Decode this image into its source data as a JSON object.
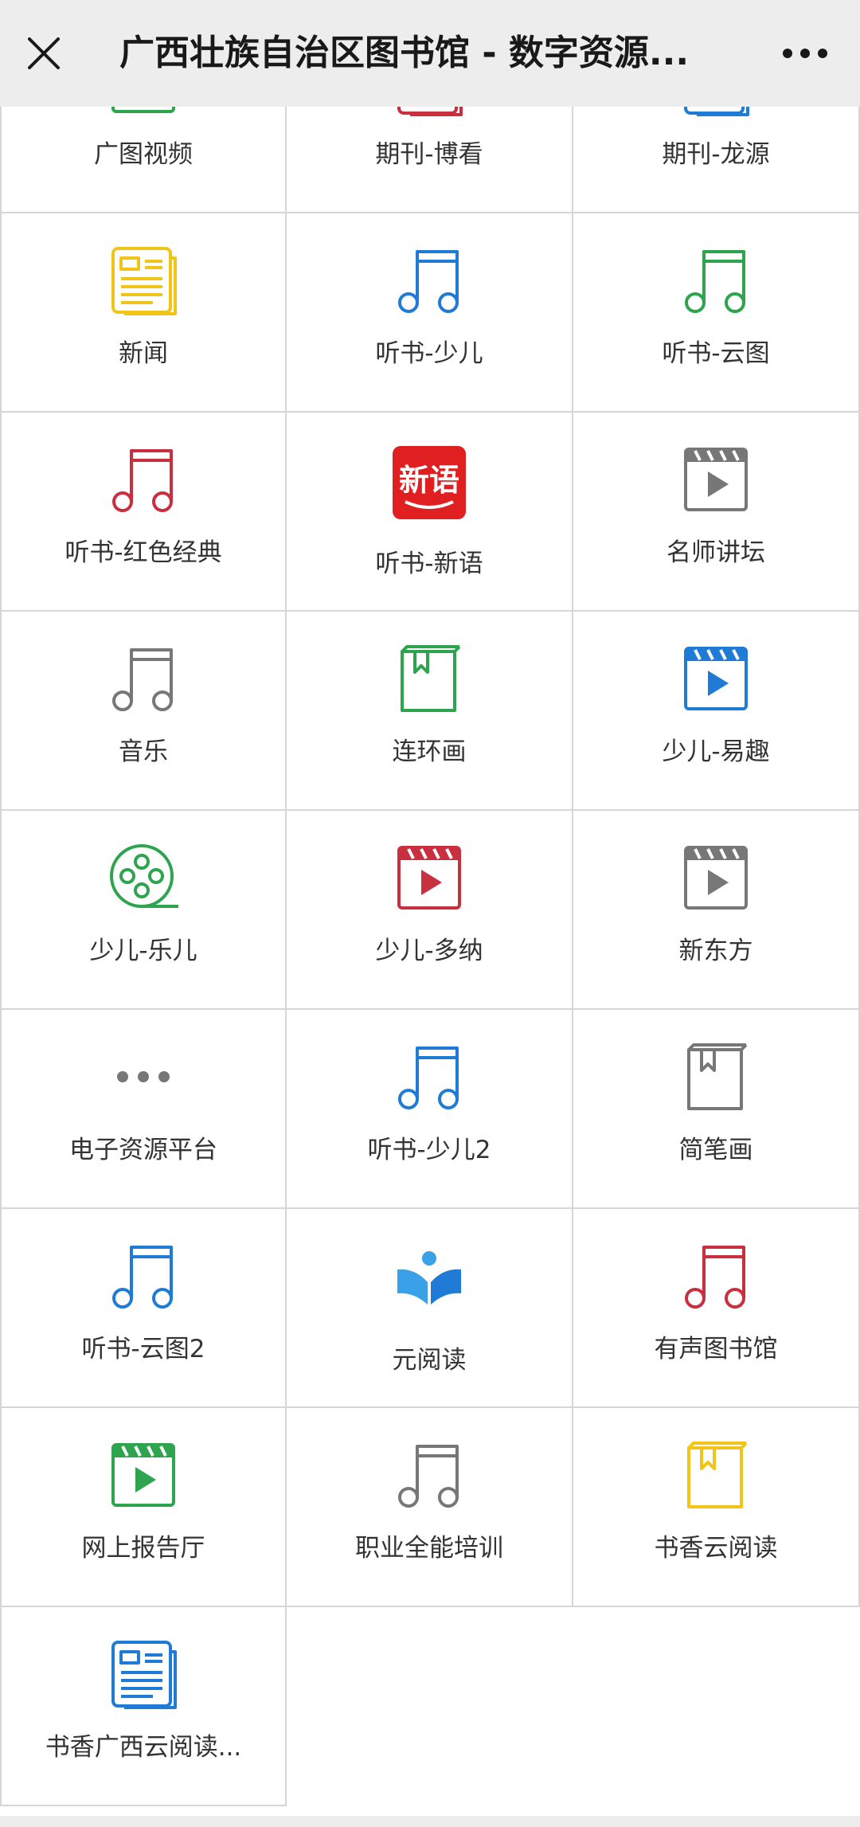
{
  "window": {
    "title": "广西壮族自治区图书馆 - 数字资源...",
    "close_icon": "close-icon",
    "more_icon": "more-icon"
  },
  "colors": {
    "green": "#2ea44f",
    "red": "#c8303f",
    "blue": "#1f7bd6",
    "yellow": "#f0c419",
    "gray": "#777777"
  },
  "tiles": [
    {
      "label": "广图视频",
      "icon": "video-icon",
      "color": "#2ea44f"
    },
    {
      "label": "期刊-博看",
      "icon": "newspaper-icon",
      "color": "#c8303f"
    },
    {
      "label": "期刊-龙源",
      "icon": "newspaper-icon",
      "color": "#1f7bd6"
    },
    {
      "label": "新闻",
      "icon": "newspaper-icon",
      "color": "#f0c419"
    },
    {
      "label": "听书-少儿",
      "icon": "music-note-icon",
      "color": "#1f7bd6"
    },
    {
      "label": "听书-云图",
      "icon": "music-note-icon",
      "color": "#2ea44f"
    },
    {
      "label": "听书-红色经典",
      "icon": "music-note-icon",
      "color": "#c8303f"
    },
    {
      "label": "听书-新语",
      "icon": "xinyu-logo-icon",
      "color": "#e02020",
      "logo_text": "新语"
    },
    {
      "label": "名师讲坛",
      "icon": "video-icon",
      "color": "#777777"
    },
    {
      "label": "音乐",
      "icon": "music-note-icon",
      "color": "#777777"
    },
    {
      "label": "连环画",
      "icon": "book-bookmark-icon",
      "color": "#2ea44f"
    },
    {
      "label": "少儿-易趣",
      "icon": "video-icon",
      "color": "#1f7bd6"
    },
    {
      "label": "少儿-乐儿",
      "icon": "film-reel-icon",
      "color": "#2ea44f"
    },
    {
      "label": "少儿-多纳",
      "icon": "video-icon",
      "color": "#c8303f"
    },
    {
      "label": "新东方",
      "icon": "video-icon",
      "color": "#777777"
    },
    {
      "label": "电子资源平台",
      "icon": "more-dots-icon",
      "color": "#777777"
    },
    {
      "label": "听书-少儿2",
      "icon": "music-note-icon",
      "color": "#1f7bd6"
    },
    {
      "label": "简笔画",
      "icon": "book-bookmark-icon",
      "color": "#777777"
    },
    {
      "label": "听书-云图2",
      "icon": "music-note-icon",
      "color": "#1f7bd6"
    },
    {
      "label": "元阅读",
      "icon": "reading-person-icon",
      "color": "#3aa0e8"
    },
    {
      "label": "有声图书馆",
      "icon": "music-note-icon",
      "color": "#c8303f"
    },
    {
      "label": "网上报告厅",
      "icon": "video-icon",
      "color": "#2ea44f"
    },
    {
      "label": "职业全能培训",
      "icon": "music-note-icon",
      "color": "#777777"
    },
    {
      "label": "书香云阅读",
      "icon": "book-bookmark-icon",
      "color": "#f0c419"
    },
    {
      "label": "书香广西云阅读...",
      "icon": "newspaper-icon",
      "color": "#1f7bd6"
    }
  ]
}
